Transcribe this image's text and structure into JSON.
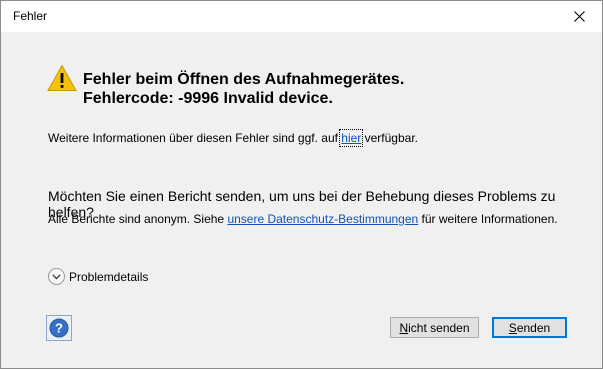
{
  "window": {
    "title": "Fehler"
  },
  "dialog": {
    "heading_line1": "Fehler beim Öffnen des Aufnahmegerätes.",
    "heading_line2": "Fehlercode: -9996 Invalid device.",
    "info_prefix": "Weitere Informationen über diesen Fehler sind ggf. auf ",
    "info_link": "hier",
    "info_suffix": " verfügbar.",
    "question": "Möchten Sie einen Bericht senden, um uns bei der Behebung dieses Problems zu helfen?",
    "anon_prefix": "Alle Berichte sind anonym. Siehe ",
    "anon_link": "unsere Datenschutz-Bestimmungen",
    "anon_suffix": " für weitere Informationen.",
    "details_label": "Problemdetails",
    "buttons": {
      "nosend_mnemonic": "N",
      "nosend_rest": "icht senden",
      "send_mnemonic": "S",
      "send_rest": "enden"
    }
  },
  "colors": {
    "link": "#0f52b8",
    "accent": "#0078d7",
    "warning": "#f4c20d"
  },
  "icons": {
    "warning": "warning-icon",
    "close": "close-icon",
    "help": "help-icon",
    "expand": "chevron-down-icon"
  }
}
